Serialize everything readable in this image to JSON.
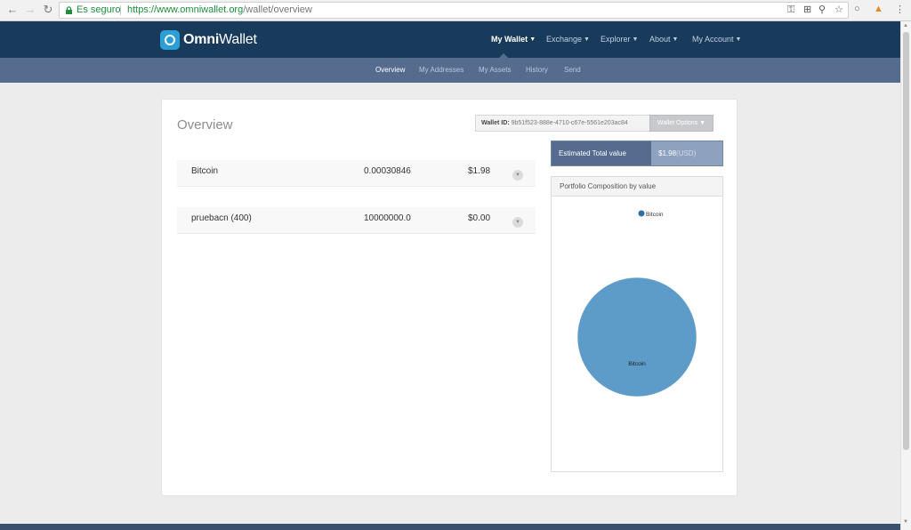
{
  "browser": {
    "secure_label": "Es seguro",
    "url_host": "https://www.omniwallet.org",
    "url_path": "/wallet/overview"
  },
  "nav": {
    "logo_prefix": "Omni",
    "logo_suffix": "Wallet",
    "items": [
      {
        "label": "My Wallet"
      },
      {
        "label": "Exchange"
      },
      {
        "label": "Explorer"
      },
      {
        "label": "About"
      },
      {
        "label": "My Account"
      }
    ],
    "sub_items": [
      {
        "label": "Overview"
      },
      {
        "label": "My Addresses"
      },
      {
        "label": "My Assets"
      },
      {
        "label": "History"
      },
      {
        "label": "Send"
      }
    ]
  },
  "main": {
    "title": "Overview",
    "wallet_id_label": "Wallet ID:",
    "wallet_id_value": "9b51f523-888e-4710-c67e-5561e203ac84",
    "wallet_options_label": "Wallet Options",
    "assets": [
      {
        "name": "Bitcoin",
        "amount": "0.00030846",
        "value": "$1.98"
      },
      {
        "name": "pruebacn (400)",
        "amount": "10000000.0",
        "value": "$0.00"
      }
    ],
    "estimated": {
      "label": "Estimated Total value",
      "value": "$1.98",
      "unit": "(USD)"
    },
    "portfolio_title": "Portfolio Composition by value"
  },
  "colors": {
    "nav_bg": "#183a5b",
    "subnav_bg": "#556c8f",
    "pie_fill": "#5d9bc9"
  },
  "chart_data": {
    "type": "pie",
    "title": "Portfolio Composition by value",
    "categories": [
      "Bitcoin"
    ],
    "values": [
      1.98
    ],
    "legend": [
      "Bitcoin"
    ]
  }
}
